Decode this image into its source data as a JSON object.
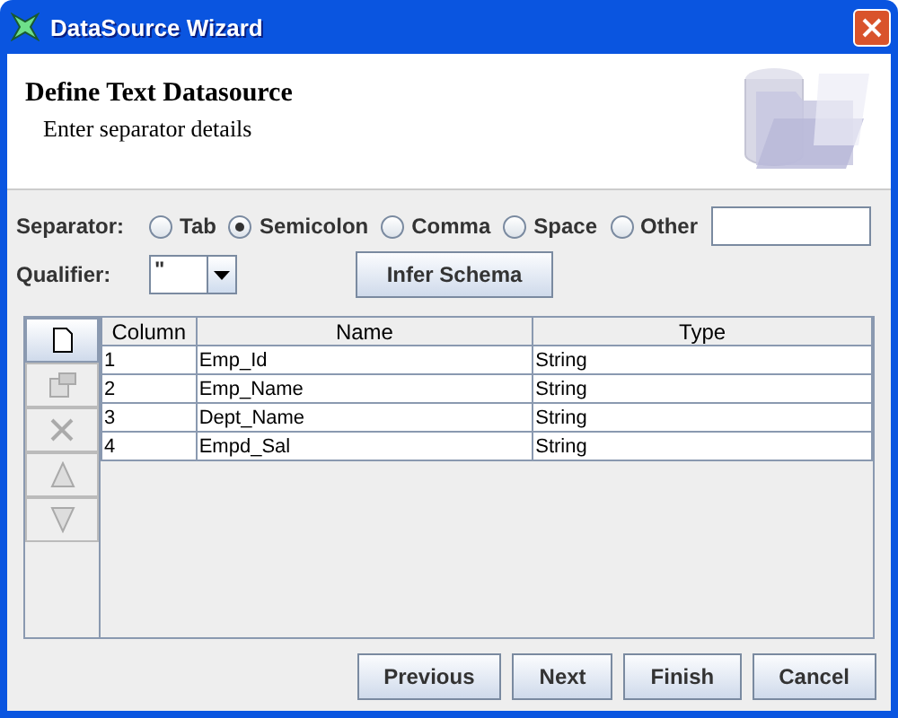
{
  "window": {
    "title": "DataSource Wizard"
  },
  "header": {
    "title": "Define Text Datasource",
    "subtitle": "Enter separator details"
  },
  "separator": {
    "label": "Separator:",
    "options": [
      {
        "label": "Tab",
        "selected": false
      },
      {
        "label": "Semicolon",
        "selected": true
      },
      {
        "label": "Comma",
        "selected": false
      },
      {
        "label": "Space",
        "selected": false
      },
      {
        "label": "Other",
        "selected": false
      }
    ]
  },
  "qualifier": {
    "label": "Qualifier:",
    "value": "\""
  },
  "infer_button": "Infer Schema",
  "toolbar": [
    {
      "kind": "new",
      "disabled": false
    },
    {
      "kind": "properties",
      "disabled": true
    },
    {
      "kind": "delete",
      "disabled": true
    },
    {
      "kind": "up",
      "disabled": true
    },
    {
      "kind": "down",
      "disabled": true
    }
  ],
  "table": {
    "columns": [
      "Column",
      "Name",
      "Type"
    ],
    "rows": [
      [
        "1",
        "Emp_Id",
        "String"
      ],
      [
        "2",
        "Emp_Name",
        "String"
      ],
      [
        "3",
        "Dept_Name",
        "String"
      ],
      [
        "4",
        "Empd_Sal",
        "String"
      ]
    ]
  },
  "buttons": [
    "Previous",
    "Next",
    "Finish",
    "Cancel"
  ]
}
